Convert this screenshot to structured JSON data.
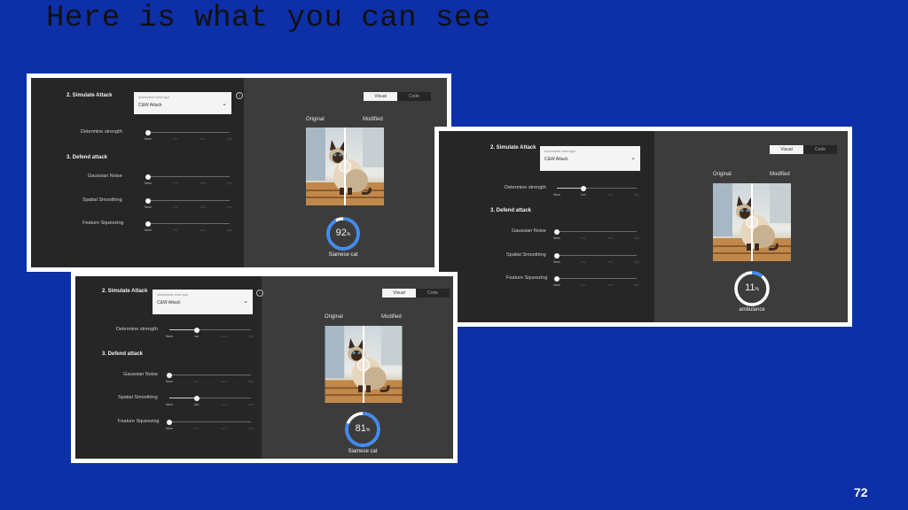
{
  "slide": {
    "title": "Here is what you can see",
    "page_number": "72"
  },
  "screenshots": [
    {
      "id": "s1",
      "section_attack": "2. Simulate Attack",
      "dropdown_placeholder": "Adversarial noise type",
      "dropdown_value": "C&W Attack",
      "determine_strength": "Determine strength",
      "section_defend": "3. Defend attack",
      "gaussian_noise": "Gaussian Noise",
      "spatial_smoothing": "Spatial Smoothing",
      "feature_squeezing": "Feature Squeezing",
      "ticks": [
        "None",
        "low",
        "med",
        "high"
      ],
      "strength_level": 0,
      "gaussian_level": 0,
      "spatial_level": 0,
      "squeezing_level": 0,
      "toggle": [
        "Visual",
        "Code"
      ],
      "original_label": "Original",
      "modified_label": "Modified",
      "confidence": "92",
      "confidence_unit": "%",
      "prediction": "Siamese cat"
    },
    {
      "id": "s2",
      "section_attack": "2. Simulate Attack",
      "dropdown_placeholder": "Adversarial noise type",
      "dropdown_value": "C&W Attack",
      "determine_strength": "Determine strength",
      "section_defend": "3. Defend attack",
      "gaussian_noise": "Gaussian Noise",
      "spatial_smoothing": "Spatial Smoothing",
      "feature_squeezing": "Feature Squeezing",
      "ticks": [
        "None",
        "low",
        "med",
        "high"
      ],
      "strength_level": 1,
      "gaussian_level": 0,
      "spatial_level": 0,
      "squeezing_level": 0,
      "toggle": [
        "Visual",
        "Code"
      ],
      "original_label": "Original",
      "modified_label": "Modified",
      "confidence": "11",
      "confidence_unit": "%",
      "prediction": "ambulance"
    },
    {
      "id": "s3",
      "section_attack": "2. Simulate Attack",
      "dropdown_placeholder": "Adversarial noise type",
      "dropdown_value": "C&W Attack",
      "determine_strength": "Determine strength",
      "section_defend": "3. Defend attack",
      "gaussian_noise": "Gaussian Noise",
      "spatial_smoothing": "Spatial Smoothing",
      "feature_squeezing": "Feature Squeezing",
      "ticks": [
        "None",
        "low",
        "med",
        "high"
      ],
      "strength_level": 1,
      "gaussian_level": 0,
      "spatial_level": 1,
      "squeezing_level": 0,
      "toggle": [
        "Visual",
        "Code"
      ],
      "original_label": "Original",
      "modified_label": "Modified",
      "confidence": "81",
      "confidence_unit": "%",
      "prediction": "Siamese cat"
    }
  ],
  "colors": {
    "background": "#0d2fa8",
    "gauge": "#3d8bff",
    "gauge_track": "#ffffff"
  }
}
